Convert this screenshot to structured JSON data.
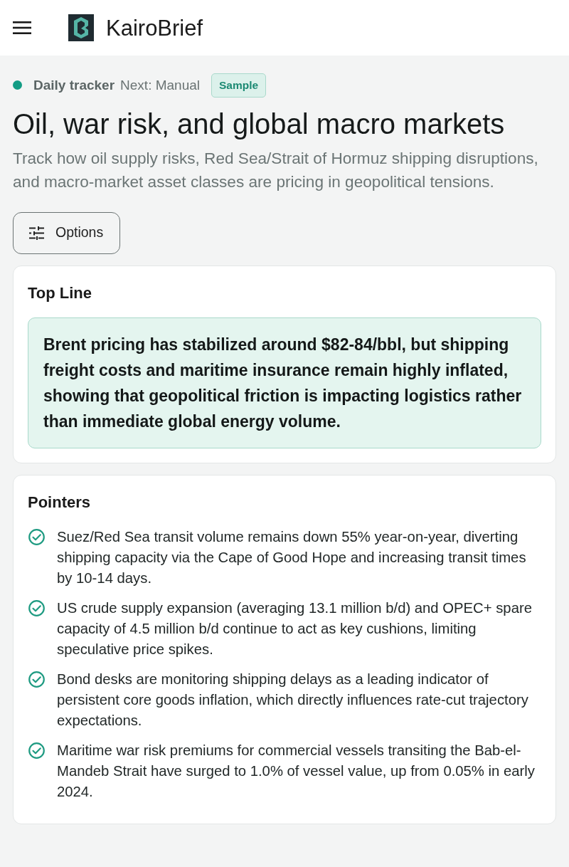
{
  "header": {
    "brand": "KairoBrief"
  },
  "status": {
    "label": "Daily tracker",
    "next": "Next: Manual",
    "badge": "Sample"
  },
  "title": "Oil, war risk, and global macro markets",
  "description": "Track how oil supply risks, Red Sea/Strait of Hormuz shipping disruptions, and macro-market asset classes are pricing in geopolitical tensions.",
  "options_button": "Options",
  "top_line": {
    "heading": "Top Line",
    "summary": "Brent pricing has stabilized around $82-84/bbl, but shipping freight costs and maritime insurance remain highly inflated, showing that geopolitical friction is impacting logistics rather than immediate global energy volume."
  },
  "pointers": {
    "heading": "Pointers",
    "items": [
      "Suez/Red Sea transit volume remains down 55% year-on-year, diverting shipping capacity via the Cape of Good Hope and increasing transit times by 10-14 days.",
      "US crude supply expansion (averaging 13.1 million b/d) and OPEC+ spare capacity of 4.5 million b/d continue to act as key cushions, limiting speculative price spikes.",
      "Bond desks are monitoring shipping delays as a leading indicator of persistent core goods inflation, which directly influences rate-cut trajectory expectations.",
      "Maritime war risk premiums for commercial vessels transiting the Bab-el-Mandeb Strait have surged to 1.0% of vessel value, up from 0.05% in early 2024."
    ]
  }
}
